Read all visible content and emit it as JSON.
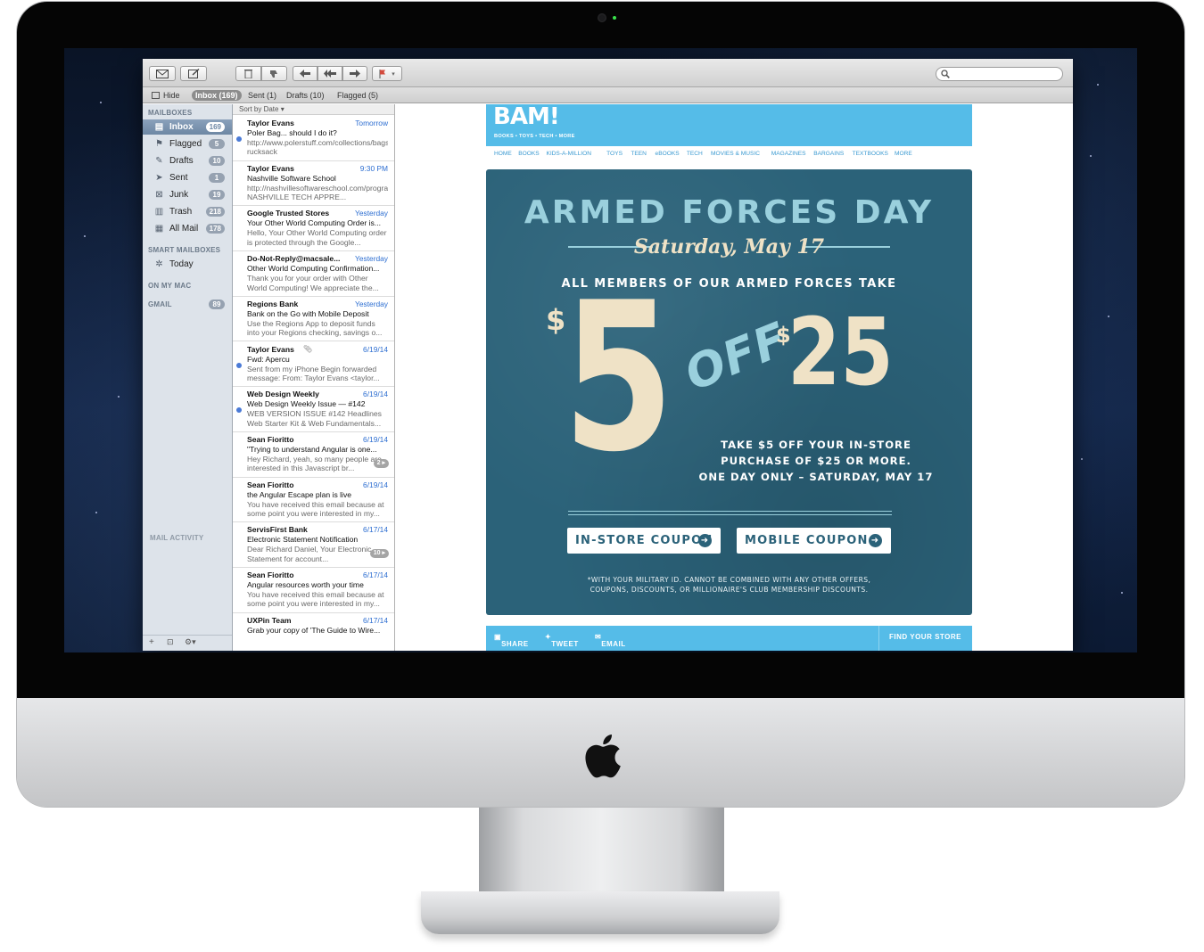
{
  "toolbar": {
    "search_placeholder": ""
  },
  "favorites": {
    "hide": "Hide",
    "inbox": "Inbox (169)",
    "sent": "Sent (1)",
    "drafts": "Drafts (10)",
    "flagged": "Flagged (5)"
  },
  "sidebar": {
    "mailboxes_header": "MAILBOXES",
    "items": [
      {
        "label": "Inbox",
        "badge": "169",
        "icon": "inbox-icon"
      },
      {
        "label": "Flagged",
        "badge": "5",
        "icon": "flag-icon"
      },
      {
        "label": "Drafts",
        "badge": "10",
        "icon": "drafts-icon"
      },
      {
        "label": "Sent",
        "badge": "1",
        "icon": "sent-icon"
      },
      {
        "label": "Junk",
        "badge": "19",
        "icon": "junk-icon"
      },
      {
        "label": "Trash",
        "badge": "218",
        "icon": "trash-icon"
      },
      {
        "label": "All Mail",
        "badge": "178",
        "icon": "archive-icon"
      }
    ],
    "smart_header": "SMART MAILBOXES",
    "today": "Today",
    "onmymac_header": "ON MY MAC",
    "gmail_header": "GMAIL",
    "gmail_badge": "89",
    "activity_header": "MAIL ACTIVITY"
  },
  "list": {
    "sort_label": "Sort by Date ▾",
    "messages": [
      {
        "sender": "Taylor Evans",
        "date": "Tomorrow",
        "subject": "Poler Bag... should I do it?",
        "preview": "http://www.polerstuff.com/collections/bags/products/the-rucksack",
        "unread": true
      },
      {
        "sender": "Taylor Evans",
        "date": "9:30 PM",
        "subject": "Nashville Software School",
        "preview": "http://nashvillesoftwareschool.com/program/ NASHVILLE TECH APPRE...",
        "unread": false
      },
      {
        "sender": "Google Trusted Stores",
        "date": "Yesterday",
        "subject": "Your Other World Computing Order is...",
        "preview": "Hello, Your Other World Computing order is protected through the Google...",
        "unread": false
      },
      {
        "sender": "Do-Not-Reply@macsale...",
        "date": "Yesterday",
        "subject": "Other World Computing Confirmation...",
        "preview": "Thank you for your order with Other World Computing! We appreciate the...",
        "unread": false
      },
      {
        "sender": "Regions Bank",
        "date": "Yesterday",
        "subject": "Bank on the Go with Mobile Deposit",
        "preview": "Use the Regions App to deposit funds into your Regions checking, savings o...",
        "unread": false
      },
      {
        "sender": "Taylor Evans",
        "date": "6/19/14",
        "subject": "Fwd: Apercu",
        "preview": "Sent from my iPhone Begin forwarded message: From: Taylor Evans <taylor...",
        "unread": true,
        "attachment": true
      },
      {
        "sender": "Web Design Weekly",
        "date": "6/19/14",
        "subject": "Web Design Weekly Issue — #142",
        "preview": "WEB VERSION ISSUE #142 Headlines Web Starter Kit & Web Fundamentals...",
        "unread": true
      },
      {
        "sender": "Sean Fioritto",
        "date": "6/19/14",
        "subject": "\"Trying to understand Angular is one...",
        "preview": "Hey Richard, yeah, so many people are interested in this Javascript br...",
        "unread": false,
        "thread": "2 ▸"
      },
      {
        "sender": "Sean Fioritto",
        "date": "6/19/14",
        "subject": "the Angular Escape plan is live",
        "preview": "You have received this email because at some point you were interested in my...",
        "unread": false
      },
      {
        "sender": "ServisFirst Bank",
        "date": "6/17/14",
        "subject": "Electronic Statement  Notification",
        "preview": "Dear Richard Daniel, Your Electronic Statement for account...",
        "unread": false,
        "thread": "10 ▸"
      },
      {
        "sender": "Sean Fioritto",
        "date": "6/17/14",
        "subject": "Angular resources worth your time",
        "preview": "You have received this email because at some point you were interested in my...",
        "unread": false
      },
      {
        "sender": "UXPin Team",
        "date": "6/17/14",
        "subject": "Grab your copy of 'The Guide to Wire...",
        "preview": "",
        "unread": false
      }
    ]
  },
  "email": {
    "logo": "BAM!",
    "tagline": "BOOKS • TOYS • TECH • MORE",
    "nav": [
      "HOME",
      "BOOKS",
      "KIDS-A-MILLION",
      "TOYS",
      "TEEN",
      "eBOOKS",
      "TECH",
      "MOVIES & MUSIC",
      "MAGAZINES",
      "BARGAINS",
      "TEXTBOOKS",
      "MORE"
    ],
    "title": "ARMED FORCES DAY",
    "date": "Saturday, May 17",
    "subtitle": "ALL MEMBERS OF OUR ARMED FORCES TAKE",
    "currency": "$",
    "amount_off": "5",
    "off_label": "OFF",
    "threshold": "25",
    "detail_line1": "TAKE $5 OFF YOUR IN-STORE",
    "detail_line2": "PURCHASE OF $25 OR MORE.",
    "detail_line3": "ONE DAY ONLY – SATURDAY, MAY 17",
    "instore_btn": "IN-STORE COUPON",
    "mobile_btn": "MOBILE COUPON",
    "fine_line1": "*WITH YOUR MILITARY ID. CANNOT BE COMBINED WITH ANY OTHER OFFERS,",
    "fine_line2": "COUPONS, DISCOUNTS, OR MILLIONAIRE'S CLUB MEMBERSHIP DISCOUNTS.",
    "share": "SHARE",
    "tweet": "TWEET",
    "email_link": "EMAIL",
    "find_store": "FIND YOUR STORE"
  },
  "colors": {
    "promo_bg": "#2b6279",
    "bam_blue": "#55bce8",
    "accent_cream": "#efe2c6",
    "accent_teal": "#9ad0dd"
  }
}
